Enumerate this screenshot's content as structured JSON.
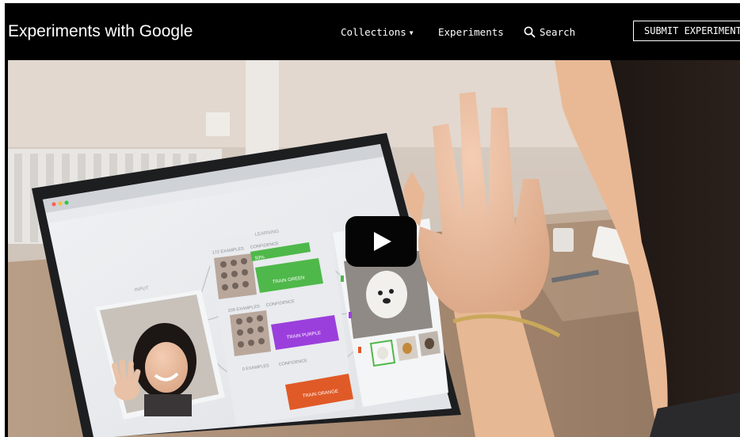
{
  "header": {
    "brand": "Experiments with Google",
    "nav": {
      "collections": "Collections",
      "experiments": "Experiments",
      "search": "Search"
    },
    "submit": "SUBMIT EXPERIMENT"
  },
  "hero": {
    "icons": [
      "play-icon",
      "search-icon",
      "caret-down-icon"
    ],
    "screen": {
      "heading_learning": "LEARNING",
      "heading_input": "INPUT",
      "rows": [
        {
          "examples": "172 EXAMPLES",
          "confidence": "CONFIDENCE",
          "percent": "93%",
          "button": "TRAIN GREEN"
        },
        {
          "examples": "209 EXAMPLES",
          "confidence": "CONFIDENCE",
          "button": "TRAIN PURPLE"
        },
        {
          "examples": "0 EXAMPLES",
          "confidence": "CONFIDENCE",
          "button": "TRAIN ORANGE"
        }
      ]
    }
  },
  "colors": {
    "header_bg": "#000000",
    "header_text": "#ffffff",
    "play_button": "#050505",
    "train_green": "#4fb84a",
    "train_purple": "#9b3fdc",
    "train_orange": "#e05a27"
  }
}
